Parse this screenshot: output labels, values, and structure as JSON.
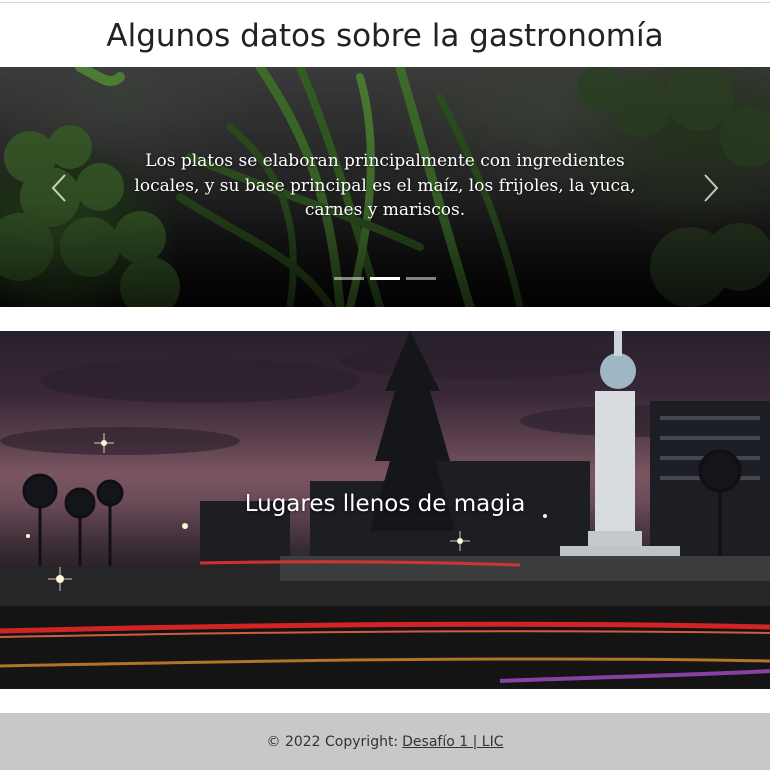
{
  "gastronomy": {
    "title": "Algunos datos sobre la gastronomía",
    "caption": "Los platos se elaboran principalmente con ingredientes locales, y su base principal es el maíz, los frijoles, la yuca, carnes y mariscos.",
    "prev_icon": "chevron-left-icon",
    "next_icon": "chevron-right-icon",
    "slides_count": 3,
    "active_slide": 2
  },
  "hero": {
    "title": "Lugares llenos de magia"
  },
  "footer": {
    "copyright": "© 2022 Copyright:",
    "link": "Desafío 1 | LIC"
  }
}
